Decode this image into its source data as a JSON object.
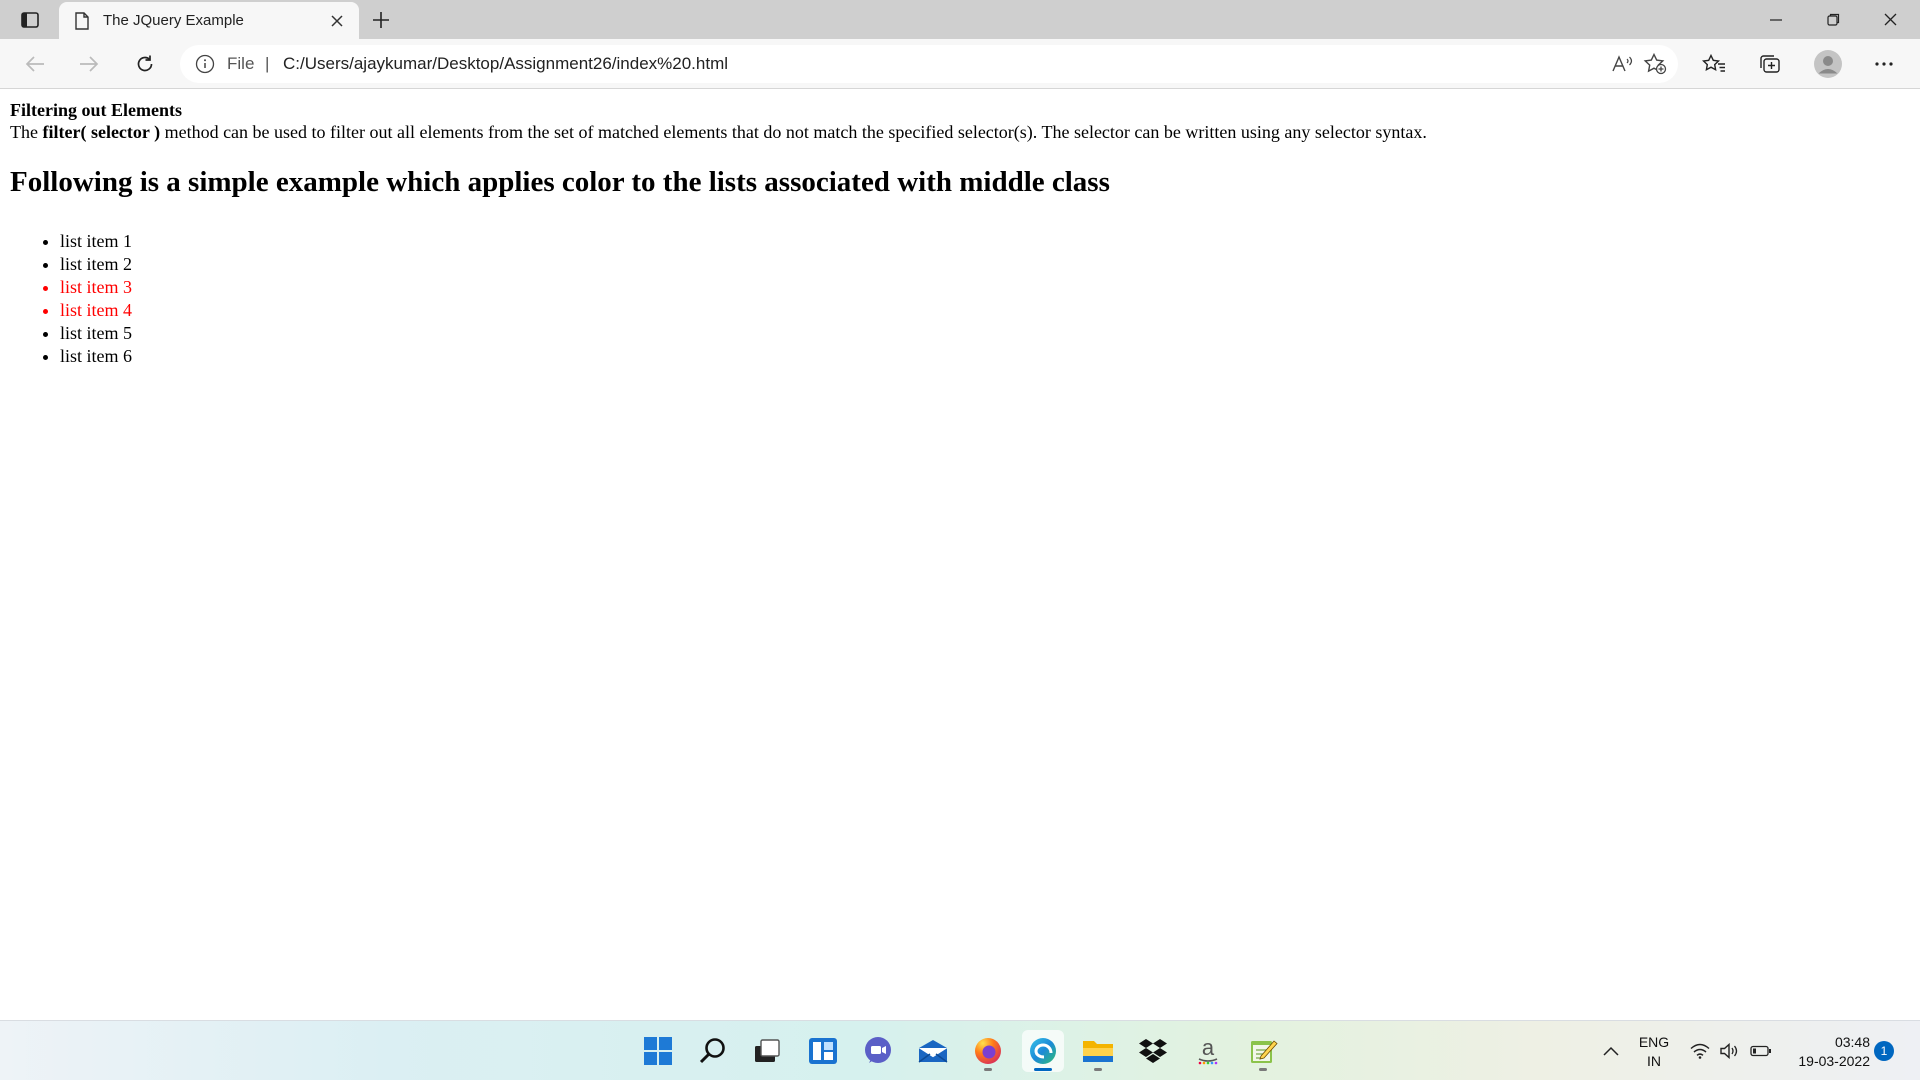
{
  "browser": {
    "tab": {
      "title": "The JQuery Example"
    },
    "address": {
      "scheme": "File",
      "separator": "|",
      "url": "C:/Users/ajaykumar/Desktop/Assignment26/index%20.html"
    },
    "icons": [
      "tab-actions-icon",
      "page-icon",
      "close-icon",
      "plus-icon",
      "minimize-icon",
      "restore-icon",
      "window-close-icon",
      "back-arrow-icon",
      "forward-arrow-icon",
      "refresh-icon",
      "info-icon",
      "read-aloud-icon",
      "add-favorite-icon",
      "favorites-icon",
      "collections-icon",
      "profile-icon",
      "more-icon"
    ]
  },
  "page": {
    "title": "Filtering out Elements",
    "description": {
      "prefix": "The",
      "method": "filter( selector )",
      "suffix": "method can be used to filter out all elements from the set of matched elements that do not match the specified selector(s). The selector can be written using any selector syntax."
    },
    "heading": "Following is a simple example which applies color to the lists associated with middle class",
    "list": [
      {
        "label": "list item 1",
        "highlighted": false
      },
      {
        "label": "list item 2",
        "highlighted": false
      },
      {
        "label": "list item 3",
        "highlighted": true
      },
      {
        "label": "list item 4",
        "highlighted": true
      },
      {
        "label": "list item 5",
        "highlighted": false
      },
      {
        "label": "list item 6",
        "highlighted": false
      }
    ],
    "highlight_color": "#ff0000"
  },
  "taskbar": {
    "apps": [
      "windows-start-icon",
      "search-icon",
      "task-view-icon",
      "widgets-icon",
      "teams-chat-icon",
      "mail-icon",
      "firefox-icon",
      "edge-icon",
      "file-explorer-icon",
      "dropbox-icon",
      "amazon-icon",
      "notepad-icon"
    ],
    "tray": {
      "language": {
        "line1": "ENG",
        "line2": "IN"
      },
      "time": "03:48",
      "date": "19-03-2022",
      "notification_count": "1"
    }
  }
}
